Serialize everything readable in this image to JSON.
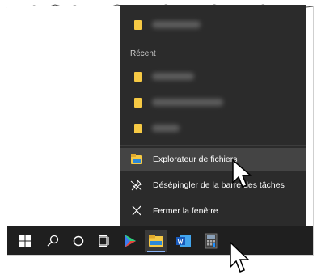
{
  "jumplist": {
    "recent_label": "Récent",
    "actions": [
      {
        "label": "Explorateur de fichiers",
        "icon": "file-explorer-icon",
        "hover": true
      },
      {
        "label": "Désépingler de la barre des tâches",
        "icon": "unpin-icon",
        "hover": false
      },
      {
        "label": "Fermer la fenêtre",
        "icon": "close-icon",
        "hover": false
      }
    ]
  },
  "taskbar": {
    "icons": [
      "windows-start-icon",
      "search-icon",
      "cortana-icon",
      "task-view-icon",
      "play-store-icon",
      "file-explorer-icon",
      "word-icon",
      "calculator-icon"
    ]
  }
}
